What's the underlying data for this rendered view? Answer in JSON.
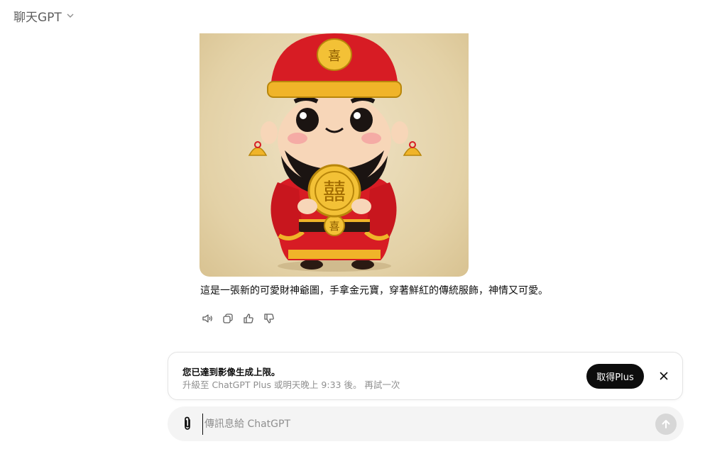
{
  "header": {
    "model_name": "聊天GPT"
  },
  "image": {
    "alt": "Cute God of Wealth holding gold ingot",
    "emblem_char": "囍",
    "belt_char": "喜"
  },
  "message": {
    "text": "這是一張新的可愛財神爺圖，手拿金元寶，穿著鮮紅的傳統服飾，神情又可愛。"
  },
  "actions": {
    "read_aloud": "speaker-icon",
    "copy": "copy-icon",
    "good": "thumbs-up-icon",
    "bad": "thumbs-down-icon"
  },
  "banner": {
    "title": "您已達到影像生成上限。",
    "subtitle": "升級至 ChatGPT Plus 或明天晚上 9:33 後。 再試一次",
    "button_label": "取得Plus"
  },
  "composer": {
    "placeholder": "傳訊息給 ChatGPT",
    "value": ""
  },
  "colors": {
    "accent_dark": "#0d0d0d",
    "composer_bg": "#f4f4f4",
    "send_disabled": "#d7d7d7"
  }
}
